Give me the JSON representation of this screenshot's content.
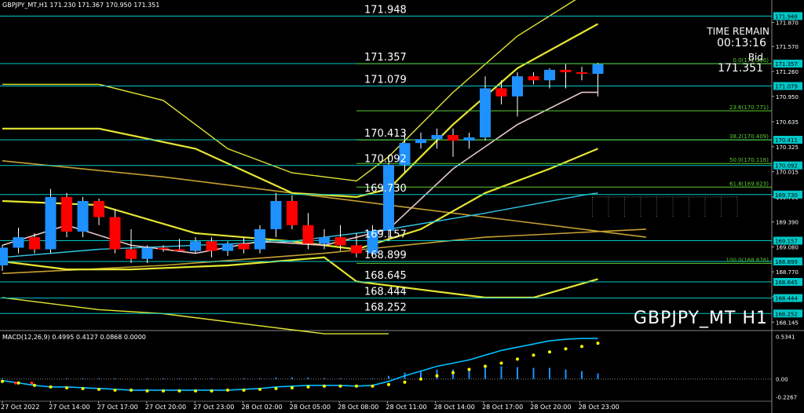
{
  "header": {
    "symbol_line": "GBPJPY_MT,H1  171.230 171.367 170.950 171.351"
  },
  "info": {
    "time_remain_label": "TIME REMAIN",
    "time_remain_value": "00:13:16",
    "bid_label": "Bid",
    "bid_value": "171.351",
    "symbol_watermark": "GBPJPY_MT H1"
  },
  "colors": {
    "background": "#000000",
    "bull": "#1e90ff",
    "bear": "#ff0000",
    "hline": "#00c8c8",
    "fib": "#5acd32",
    "band": "#e6e632",
    "macd_signal": "#ffff00",
    "macd_main": "#00bfff",
    "macd_hist": "#1e90ff"
  },
  "chart_data": [
    {
      "type": "candlestick",
      "title": "GBPJPY_MT,H1",
      "ylim": [
        168.05,
        172.05
      ],
      "y_ticks": [
        "171.870",
        "171.570",
        "171.260",
        "170.950",
        "170.635",
        "170.325",
        "170.015",
        "169.700",
        "169.390",
        "169.080",
        "168.770",
        "168.460",
        "168.145"
      ],
      "x_ticks": [
        "27 Oct 2022",
        "27 Oct 14:00",
        "27 Oct 17:00",
        "27 Oct 20:00",
        "27 Oct 23:00",
        "28 Oct 02:00",
        "28 Oct 05:00",
        "28 Oct 08:00",
        "28 Oct 11:00",
        "28 Oct 14:00",
        "28 Oct 17:00",
        "28 Oct 20:00",
        "28 Oct 23:00"
      ],
      "candles": [
        {
          "o": 168.85,
          "h": 169.1,
          "l": 168.78,
          "c": 169.07
        },
        {
          "o": 169.07,
          "h": 169.32,
          "l": 169.0,
          "c": 169.2
        },
        {
          "o": 169.2,
          "h": 169.25,
          "l": 169.0,
          "c": 169.05
        },
        {
          "o": 169.05,
          "h": 169.8,
          "l": 169.0,
          "c": 169.7
        },
        {
          "o": 169.7,
          "h": 169.75,
          "l": 169.2,
          "c": 169.27
        },
        {
          "o": 169.27,
          "h": 169.7,
          "l": 169.2,
          "c": 169.65
        },
        {
          "o": 169.65,
          "h": 169.68,
          "l": 169.35,
          "c": 169.45
        },
        {
          "o": 169.45,
          "h": 169.55,
          "l": 169.0,
          "c": 169.05
        },
        {
          "o": 169.05,
          "h": 169.3,
          "l": 168.88,
          "c": 168.93
        },
        {
          "o": 168.93,
          "h": 169.1,
          "l": 168.88,
          "c": 169.07
        },
        {
          "o": 169.07,
          "h": 169.1,
          "l": 169.02,
          "c": 169.05
        },
        {
          "o": 169.05,
          "h": 169.18,
          "l": 169.02,
          "c": 169.03
        },
        {
          "o": 169.03,
          "h": 169.2,
          "l": 169.0,
          "c": 169.15
        },
        {
          "o": 169.15,
          "h": 169.2,
          "l": 168.95,
          "c": 169.03
        },
        {
          "o": 169.03,
          "h": 169.15,
          "l": 168.97,
          "c": 169.12
        },
        {
          "o": 169.12,
          "h": 169.2,
          "l": 169.0,
          "c": 169.05
        },
        {
          "o": 169.05,
          "h": 169.35,
          "l": 169.0,
          "c": 169.3
        },
        {
          "o": 169.3,
          "h": 169.75,
          "l": 169.2,
          "c": 169.65
        },
        {
          "o": 169.65,
          "h": 169.72,
          "l": 169.3,
          "c": 169.35
        },
        {
          "o": 169.35,
          "h": 169.5,
          "l": 169.05,
          "c": 169.12
        },
        {
          "o": 169.12,
          "h": 169.3,
          "l": 169.05,
          "c": 169.2
        },
        {
          "o": 169.2,
          "h": 169.35,
          "l": 169.03,
          "c": 169.1
        },
        {
          "o": 169.1,
          "h": 169.25,
          "l": 168.95,
          "c": 169.0
        },
        {
          "o": 169.0,
          "h": 169.35,
          "l": 168.97,
          "c": 169.28
        },
        {
          "o": 169.28,
          "h": 170.2,
          "l": 169.15,
          "c": 170.1
        },
        {
          "o": 170.1,
          "h": 170.5,
          "l": 170.0,
          "c": 170.37
        },
        {
          "o": 170.37,
          "h": 170.5,
          "l": 170.3,
          "c": 170.42
        },
        {
          "o": 170.42,
          "h": 170.55,
          "l": 170.3,
          "c": 170.47
        },
        {
          "o": 170.47,
          "h": 170.55,
          "l": 170.2,
          "c": 170.4
        },
        {
          "o": 170.4,
          "h": 170.5,
          "l": 170.3,
          "c": 170.44
        },
        {
          "o": 170.44,
          "h": 171.2,
          "l": 170.4,
          "c": 171.05
        },
        {
          "o": 171.05,
          "h": 171.15,
          "l": 170.85,
          "c": 170.95
        },
        {
          "o": 170.95,
          "h": 171.25,
          "l": 170.7,
          "c": 171.2
        },
        {
          "o": 171.2,
          "h": 171.25,
          "l": 171.1,
          "c": 171.15
        },
        {
          "o": 171.15,
          "h": 171.3,
          "l": 171.05,
          "c": 171.28
        },
        {
          "o": 171.28,
          "h": 171.35,
          "l": 171.05,
          "c": 171.25
        },
        {
          "o": 171.25,
          "h": 171.32,
          "l": 171.15,
          "c": 171.23
        },
        {
          "o": 171.23,
          "h": 171.367,
          "l": 170.95,
          "c": 171.351
        }
      ],
      "price_lines": [
        {
          "price": 171.948,
          "label": "171.948"
        },
        {
          "price": 171.357,
          "label": "171.357"
        },
        {
          "price": 171.079,
          "label": "171.079"
        },
        {
          "price": 170.411,
          "label": "170.411"
        },
        {
          "price": 170.092,
          "label": "170.092"
        },
        {
          "price": 169.73,
          "label": "169.730"
        },
        {
          "price": 169.157,
          "label": "169.157"
        },
        {
          "price": 168.899,
          "label": "168.899"
        },
        {
          "price": 168.645,
          "label": "168.645"
        },
        {
          "price": 168.444,
          "label": "168.444"
        },
        {
          "price": 168.252,
          "label": "168.252"
        }
      ],
      "left_price_labels": [
        {
          "price": 171.948,
          "text": "171.948"
        },
        {
          "price": 171.357,
          "text": "171.357"
        },
        {
          "price": 171.079,
          "text": "171.079"
        },
        {
          "price": 170.411,
          "text": "170.413"
        },
        {
          "price": 170.092,
          "text": "170.092"
        },
        {
          "price": 169.73,
          "text": "169.730"
        },
        {
          "price": 169.157,
          "text": "169.157"
        },
        {
          "price": 168.899,
          "text": "168.899"
        },
        {
          "price": 168.645,
          "text": "168.645"
        },
        {
          "price": 168.444,
          "text": "168.444"
        },
        {
          "price": 168.252,
          "text": "168.252"
        }
      ],
      "fib_levels": [
        {
          "price": 171.356,
          "text": "0.0(171.356)"
        },
        {
          "price": 170.771,
          "text": "23.6(170.771)"
        },
        {
          "price": 170.409,
          "text": "38.2(170.409)"
        },
        {
          "price": 170.116,
          "text": "50.0(170.116)"
        },
        {
          "price": 169.823,
          "text": "61.8(169.823)"
        },
        {
          "price": 168.876,
          "text": "100.0(168.876)"
        }
      ],
      "bands": {
        "upper_outer": [
          [
            0,
            171.1
          ],
          [
            6,
            171.1
          ],
          [
            10,
            170.9
          ],
          [
            14,
            170.3
          ],
          [
            18,
            170.0
          ],
          [
            22,
            169.9
          ],
          [
            24,
            170.2
          ],
          [
            28,
            171.0
          ],
          [
            32,
            171.7
          ],
          [
            36,
            172.2
          ],
          [
            37,
            172.4
          ]
        ],
        "upper_inner": [
          [
            0,
            170.55
          ],
          [
            6,
            170.55
          ],
          [
            12,
            170.3
          ],
          [
            18,
            169.75
          ],
          [
            22,
            169.7
          ],
          [
            24,
            169.8
          ],
          [
            28,
            170.6
          ],
          [
            32,
            171.3
          ],
          [
            37,
            171.85
          ]
        ],
        "mid": [
          [
            0,
            169.65
          ],
          [
            6,
            169.6
          ],
          [
            12,
            169.25
          ],
          [
            18,
            169.15
          ],
          [
            22,
            169.05
          ],
          [
            26,
            169.3
          ],
          [
            30,
            169.75
          ],
          [
            34,
            170.05
          ],
          [
            37,
            170.3
          ]
        ],
        "lower_inner": [
          [
            0,
            168.9
          ],
          [
            4,
            168.8
          ],
          [
            8,
            168.8
          ],
          [
            14,
            168.85
          ],
          [
            20,
            168.95
          ],
          [
            22,
            168.65
          ],
          [
            26,
            168.55
          ],
          [
            30,
            168.45
          ],
          [
            33,
            168.45
          ],
          [
            37,
            168.68
          ]
        ],
        "lower_outer": [
          [
            0,
            168.45
          ],
          [
            6,
            168.3
          ],
          [
            10,
            168.25
          ],
          [
            16,
            168.1
          ],
          [
            20,
            168.0
          ],
          [
            24,
            168.0
          ]
        ],
        "long_ma": [
          [
            0,
            168.75
          ],
          [
            10,
            168.85
          ],
          [
            20,
            169.0
          ],
          [
            30,
            169.2
          ],
          [
            40,
            169.3
          ]
        ],
        "declining_ma": [
          [
            0,
            170.15
          ],
          [
            10,
            169.95
          ],
          [
            20,
            169.7
          ],
          [
            30,
            169.45
          ],
          [
            40,
            169.2
          ]
        ],
        "fast_ma": [
          [
            0,
            169.1
          ],
          [
            4,
            169.35
          ],
          [
            8,
            169.1
          ],
          [
            12,
            169.0
          ],
          [
            16,
            169.15
          ],
          [
            20,
            169.1
          ],
          [
            24,
            169.3
          ],
          [
            28,
            170.05
          ],
          [
            32,
            170.6
          ],
          [
            36,
            171.0
          ],
          [
            37,
            171.0
          ]
        ],
        "cyan_ma": [
          [
            0,
            168.95
          ],
          [
            6,
            169.05
          ],
          [
            12,
            169.1
          ],
          [
            18,
            169.15
          ],
          [
            24,
            169.3
          ],
          [
            30,
            169.5
          ],
          [
            36,
            169.72
          ],
          [
            37,
            169.75
          ]
        ]
      },
      "ichimoku_cloud": {
        "from": 37,
        "to": 46,
        "top": 169.7,
        "bottom": 169.45
      }
    },
    {
      "type": "macd",
      "title": "MACD(12,26,9) 0.4995 0.4127 0.0868 0.0000",
      "y_ticks": [
        "0.5341",
        "0.00",
        "-0.2267"
      ],
      "ylim": [
        -0.27,
        0.6
      ],
      "macd": [
        -0.02,
        -0.05,
        -0.08,
        -0.1,
        -0.1,
        -0.11,
        -0.12,
        -0.13,
        -0.14,
        -0.14,
        -0.14,
        -0.14,
        -0.14,
        -0.14,
        -0.14,
        -0.13,
        -0.12,
        -0.1,
        -0.09,
        -0.08,
        -0.08,
        -0.08,
        -0.09,
        -0.08,
        -0.03,
        0.04,
        0.1,
        0.16,
        0.2,
        0.24,
        0.3,
        0.36,
        0.4,
        0.44,
        0.48,
        0.5,
        0.51,
        0.51
      ],
      "signal": [
        -0.03,
        -0.05,
        -0.08,
        -0.1,
        -0.11,
        -0.12,
        -0.13,
        -0.14,
        -0.14,
        -0.15,
        -0.15,
        -0.15,
        -0.15,
        -0.15,
        -0.14,
        -0.14,
        -0.13,
        -0.12,
        -0.11,
        -0.1,
        -0.09,
        -0.09,
        -0.09,
        -0.09,
        -0.07,
        -0.04,
        0.0,
        0.04,
        0.08,
        0.12,
        0.16,
        0.2,
        0.25,
        0.3,
        0.34,
        0.38,
        0.41,
        0.45
      ],
      "histogram": [
        0.01,
        0.0,
        0.0,
        0.0,
        0.01,
        0.01,
        0.01,
        0.01,
        0.0,
        0.01,
        0.01,
        0.01,
        0.01,
        0.01,
        0.0,
        0.01,
        0.01,
        0.02,
        0.02,
        0.02,
        0.01,
        0.01,
        0.0,
        0.01,
        0.04,
        0.08,
        0.1,
        0.12,
        0.12,
        0.12,
        0.14,
        0.16,
        0.15,
        0.14,
        0.14,
        0.12,
        0.1,
        0.07
      ]
    }
  ]
}
